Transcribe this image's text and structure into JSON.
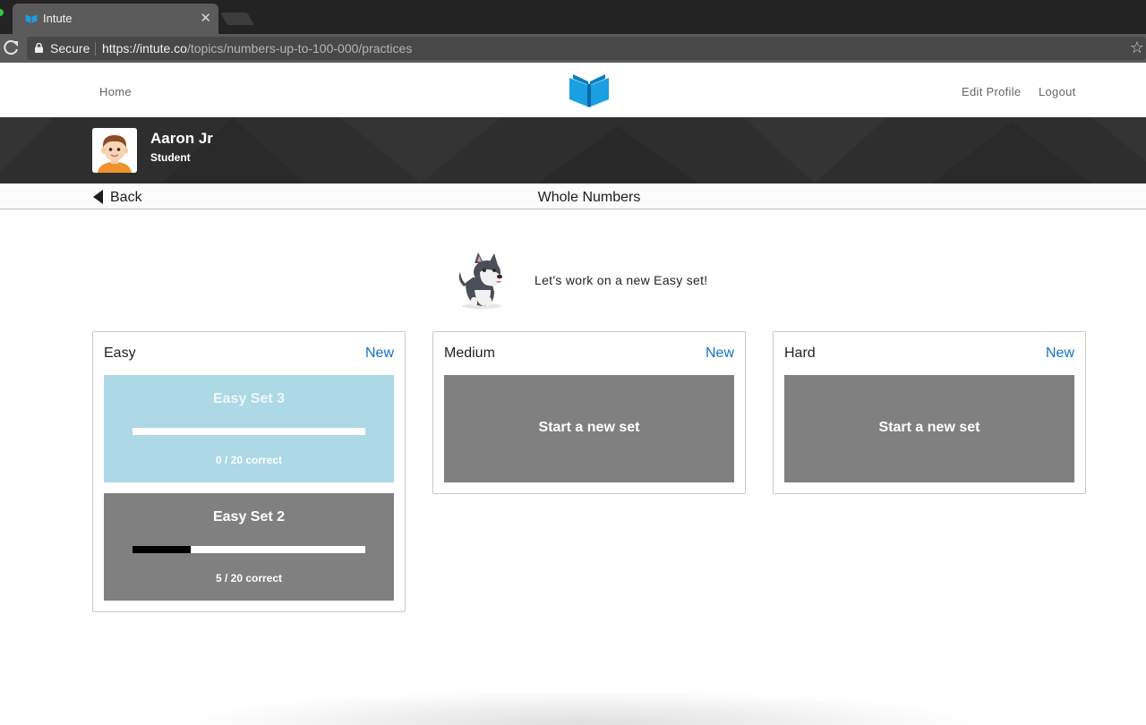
{
  "browser": {
    "tab_title": "Intute",
    "secure_label": "Secure",
    "url_scheme": "https://",
    "url_host": "intute.co",
    "url_path": "/topics/numbers-up-to-100-000/practices"
  },
  "nav": {
    "home": "Home",
    "edit_profile": "Edit Profile",
    "logout": "Logout",
    "logo_icon": "open-book-icon",
    "logo_color": "#1a9fe0"
  },
  "profile": {
    "name": "Aaron Jr",
    "role": "Student"
  },
  "subheader": {
    "back_label": "Back",
    "title": "Whole Numbers"
  },
  "mascot": {
    "icon": "husky-dog-icon",
    "message": "Let's work on a new Easy set!"
  },
  "levels": [
    {
      "title": "Easy",
      "new_label": "New",
      "sets": [
        {
          "title": "Easy Set 3",
          "correct": 0,
          "total": 20,
          "progress_text": "0 / 20 correct",
          "color": "#add8e6"
        },
        {
          "title": "Easy Set 2",
          "correct": 5,
          "total": 20,
          "progress_text": "5 / 20 correct",
          "color": "#808080"
        }
      ]
    },
    {
      "title": "Medium",
      "new_label": "New",
      "start_label": "Start a new set"
    },
    {
      "title": "Hard",
      "new_label": "New",
      "start_label": "Start a new set"
    }
  ],
  "colors": {
    "accent": "#1473c6",
    "banner": "#2e2e2e",
    "card_gray": "#808080",
    "card_current": "#add8e6"
  }
}
